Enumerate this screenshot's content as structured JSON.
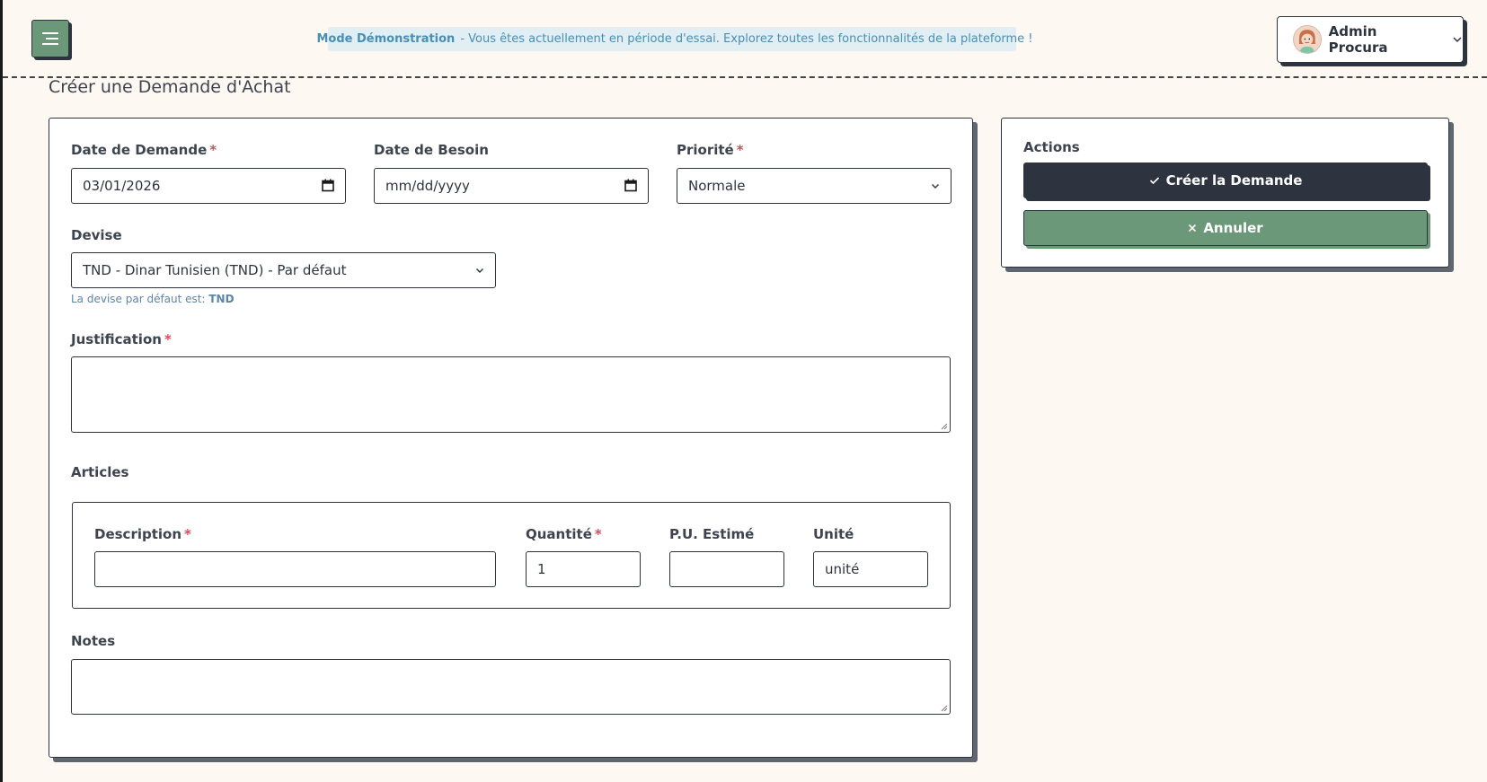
{
  "header": {
    "menu_icon": "menu-icon",
    "banner": {
      "icon": "info-icon",
      "title": "Mode Démonstration",
      "message": "- Vous êtes actuellement en période d'essai. Explorez toutes les fonctionnalités de la plateforme !"
    },
    "user": {
      "name": "Admin Procura",
      "avatar_icon": "avatar-icon",
      "dropdown_icon": "chevron-down-icon"
    }
  },
  "page": {
    "title": "Créer une Demande d'Achat"
  },
  "form": {
    "date_demande": {
      "label": "Date de Demande",
      "required": "*",
      "value": "03/01/2026"
    },
    "date_besoin": {
      "label": "Date de Besoin",
      "value": "mm/dd/yyyy"
    },
    "priorite": {
      "label": "Priorité",
      "required": "*",
      "value": "Normale"
    },
    "devise": {
      "label": "Devise",
      "value": "TND - Dinar Tunisien (TND) - Par défaut",
      "hint_prefix": "La devise par défaut est:",
      "hint_value": "TND"
    },
    "justification": {
      "label": "Justification",
      "required": "*",
      "value": ""
    },
    "articles": {
      "label": "Articles",
      "description": {
        "label": "Description",
        "required": "*",
        "value": ""
      },
      "quantite": {
        "label": "Quantité",
        "required": "*",
        "value": "1"
      },
      "pu_estime": {
        "label": "P.U. Estimé",
        "value": ""
      },
      "unite": {
        "label": "Unité",
        "value": "unité"
      }
    },
    "notes": {
      "label": "Notes",
      "value": ""
    }
  },
  "actions": {
    "title": "Actions",
    "create_label": "Créer la Demande",
    "create_icon": "check-icon",
    "cancel_label": "Annuler",
    "cancel_icon": "close-icon"
  },
  "colors": {
    "background": "#fdf8f1",
    "dark": "#2d3440",
    "green": "#6a9878",
    "banner_bg": "#e1eef3",
    "banner_text": "#4a8fb3",
    "required": "#e0485b"
  }
}
